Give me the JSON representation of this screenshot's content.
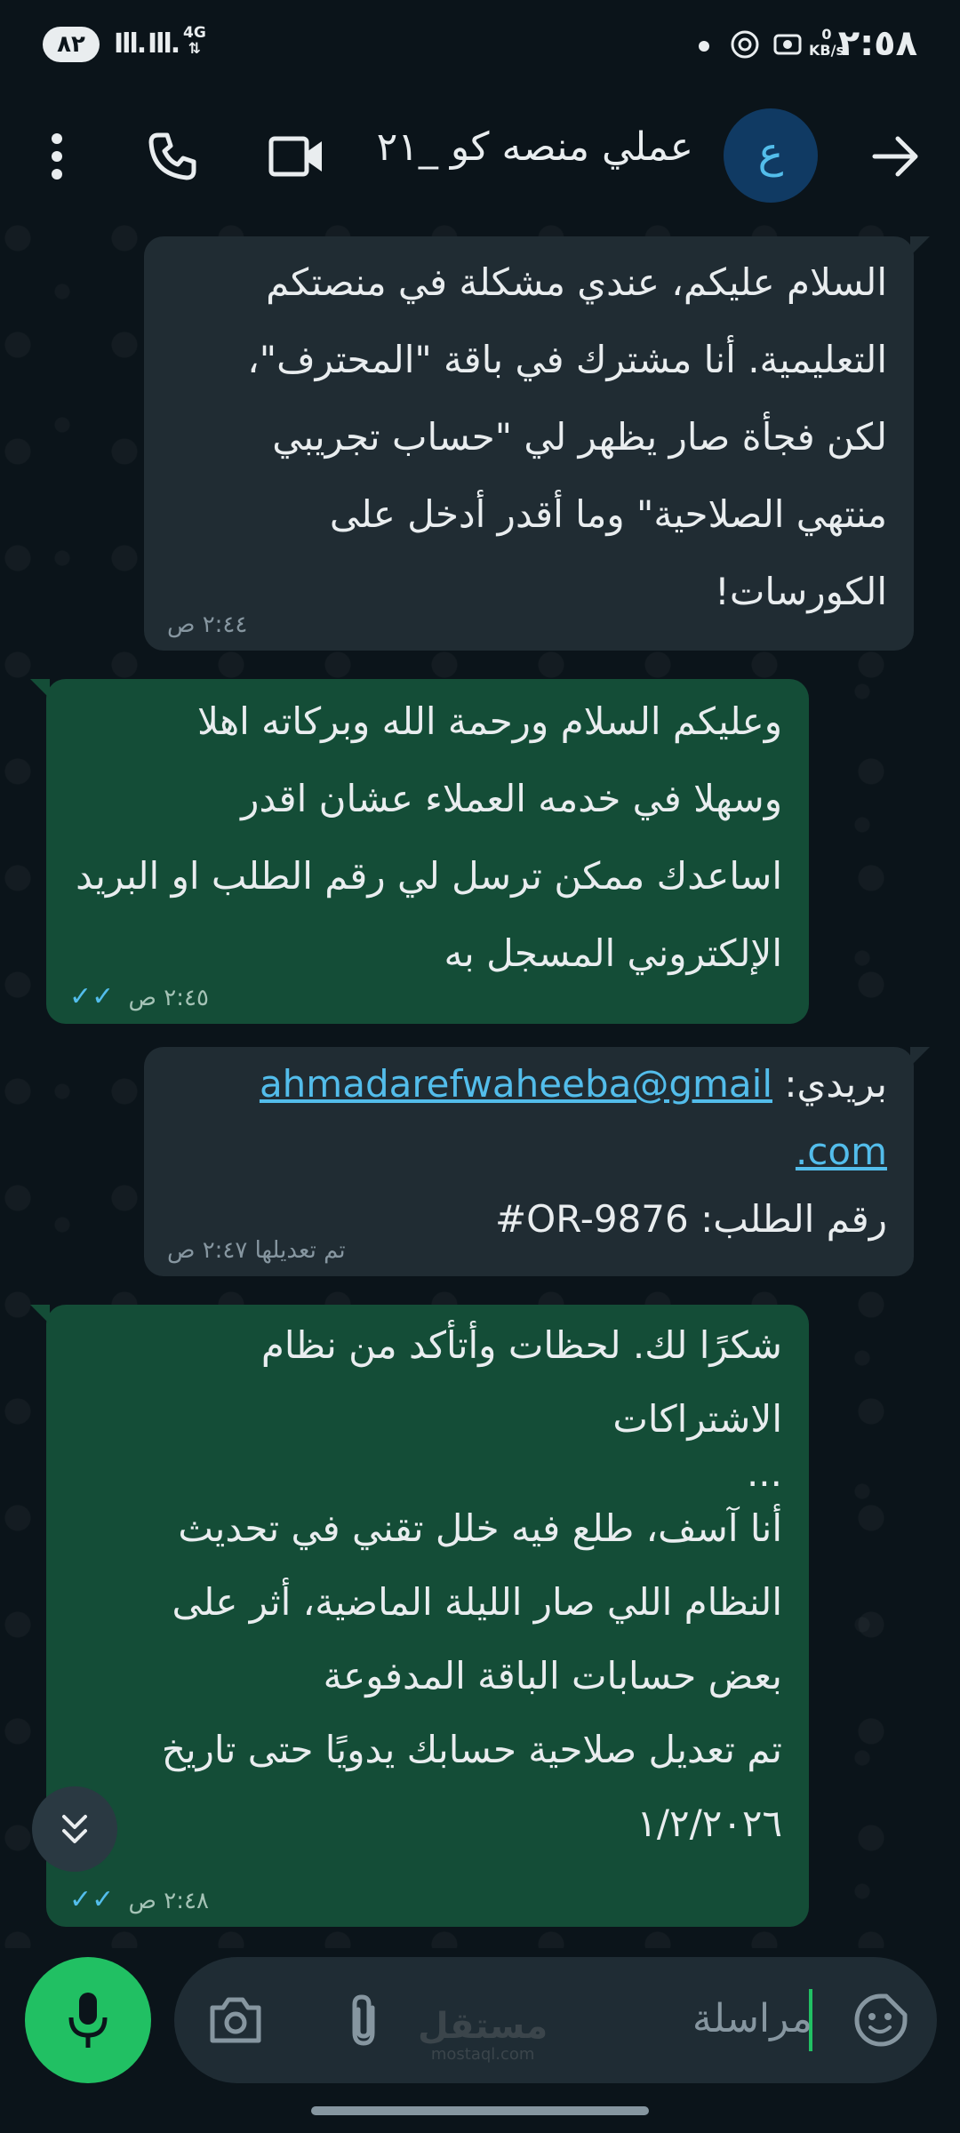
{
  "status_bar": {
    "time": "٢:٥٨",
    "battery": "٨٢",
    "network_type": "4G",
    "speed_value": "0",
    "speed_unit": "KB/s"
  },
  "header": {
    "avatar_letter": "ع",
    "title": "عملي منصه كو _٢١"
  },
  "messages": [
    {
      "direction": "incoming",
      "lines": [
        "السلام عليكم، عندي مشكلة في منصتكم",
        "التعليمية. أنا مشترك في باقة \"المحترف\"،",
        "لكن فجأة صار يظهر لي \"حساب تجريبي",
        "منتهي الصلاحية\" وما أقدر أدخل على",
        "الكورسات!"
      ],
      "time": "٢:٤٤ ص"
    },
    {
      "direction": "outgoing",
      "lines": [
        "وعليكم السلام ورحمة الله وبركاته اهلا",
        "وسهلا في خدمه العملاء  عشان اقدر",
        "اساعدك ممكن ترسل لي رقم الطلب او البريد",
        "الإلكتروني المسجل به"
      ],
      "time": "٢:٤٥ ص"
    },
    {
      "direction": "incoming",
      "email_label": "بريدي:",
      "email_part1": "ahmadarefwaheeba@gmail",
      "email_part2": ".com",
      "order_label": "رقم الطلب:",
      "order_number": "#OR-9876",
      "edited_label": "تم تعديلها",
      "time": "٢:٤٧ ص"
    },
    {
      "direction": "outgoing",
      "lines": [
        "شكرًا لك. لحظات وأتأكد من نظام",
        "الاشتراكات",
        "...",
        "أنا آسف، طلع فيه خلل تقني في تحديث",
        "النظام اللي صار الليلة الماضية، أثر على",
        "بعض حسابات الباقة المدفوعة",
        "تم تعديل صلاحية حسابك يدويًا حتى تاريخ",
        "١/٢/٢٠٢٦"
      ],
      "time": "٢:٤٨ ص"
    }
  ],
  "input_bar": {
    "placeholder": "مراسلة"
  },
  "watermark": {
    "arabic": "مستقل",
    "latin": "mostaql.com"
  },
  "colors": {
    "background": "#0b141a",
    "incoming_bubble": "#202c33",
    "outgoing_bubble": "#144d37",
    "accent_green": "#21c063",
    "link_blue": "#53bdeb"
  }
}
